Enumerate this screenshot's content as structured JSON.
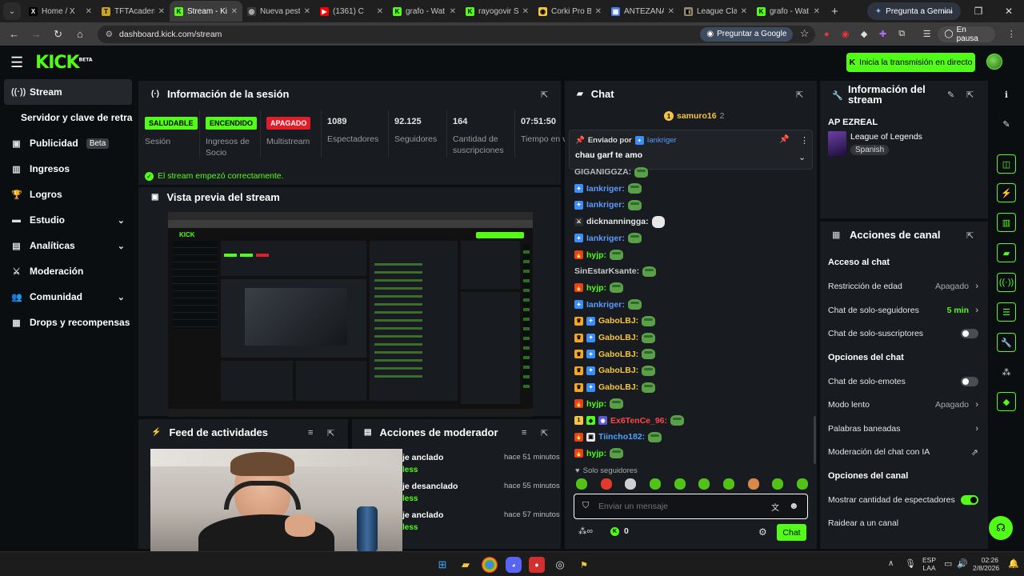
{
  "browser": {
    "tabs": [
      {
        "title": "Home / X",
        "fav": "X",
        "color": "#000000",
        "fg": "#ffffff"
      },
      {
        "title": "TFTAcadem",
        "fav": "T",
        "color": "#c9a227",
        "fg": "#000000"
      },
      {
        "title": "Stream - Kic",
        "fav": "K",
        "color": "#53fc18",
        "fg": "#000000"
      },
      {
        "title": "Nueva pesta",
        "fav": "◎",
        "color": "#3c3c3c",
        "fg": "#ffffff"
      },
      {
        "title": "(1361) C",
        "fav": "▶",
        "color": "#ff0000",
        "fg": "#ffffff"
      },
      {
        "title": "grafo - Wat",
        "fav": "K",
        "color": "#53fc18",
        "fg": "#000000"
      },
      {
        "title": "rayogovir S",
        "fav": "K",
        "color": "#53fc18",
        "fg": "#000000"
      },
      {
        "title": "Corki Pro B",
        "fav": "◉",
        "color": "#f4c542",
        "fg": "#000000"
      },
      {
        "title": "ANTEZANA",
        "fav": "▦",
        "color": "#4a7cf6",
        "fg": "#ffffff"
      },
      {
        "title": "League Clas",
        "fav": "◧",
        "color": "#9a8b6e",
        "fg": "#000000"
      },
      {
        "title": "grafo - Wat",
        "fav": "K",
        "color": "#53fc18",
        "fg": "#000000"
      }
    ],
    "gemini_label": "Pregunta a Gemini",
    "url": "dashboard.kick.com/stream",
    "google_label": "Preguntar a Google",
    "pause_label": "En pausa"
  },
  "header": {
    "logo": "KICK",
    "logo_sup": "BETA",
    "live_button": "Inicia la transmisión en directo"
  },
  "sidebar": {
    "items": [
      {
        "label": "Stream",
        "icon": "broadcast-icon",
        "glyph": "((·))",
        "active": true
      },
      {
        "label": "Servidor y clave de retransmisión",
        "sub": true
      },
      {
        "label": "Publicidad",
        "icon": "calendar-icon",
        "glyph": "▣",
        "badge": "Beta"
      },
      {
        "label": "Ingresos",
        "icon": "chart-icon",
        "glyph": "▥"
      },
      {
        "label": "Logros",
        "icon": "trophy-icon",
        "glyph": "🏆"
      },
      {
        "label": "Estudio",
        "icon": "studio-icon",
        "glyph": "▬",
        "chevron": true
      },
      {
        "label": "Analíticas",
        "icon": "analytics-icon",
        "glyph": "▤",
        "chevron": true
      },
      {
        "label": "Moderación",
        "icon": "sword-icon",
        "glyph": "⚔"
      },
      {
        "label": "Comunidad",
        "icon": "community-icon",
        "glyph": "👥",
        "chevron": true
      },
      {
        "label": "Drops y recompensas",
        "icon": "gift-icon",
        "glyph": "▦"
      }
    ]
  },
  "session": {
    "title": "Información de la sesión",
    "stats": [
      {
        "pill": "SALUDABLE",
        "pill_bg": "#53fc18",
        "label": "Sesión"
      },
      {
        "pill": "ENCENDIDO",
        "pill_bg": "#53fc18",
        "label": "Ingresos de Socio"
      },
      {
        "pill": "APAGADO",
        "pill_bg": "#e11d2a",
        "label": "Multistream"
      },
      {
        "value": "1089",
        "label": "Espectadores"
      },
      {
        "value": "92.125",
        "label": "Seguidores"
      },
      {
        "value": "164",
        "label": "Cantidad de suscripciones"
      },
      {
        "value": "07:51:50",
        "label": "Tiempo en vivo"
      }
    ],
    "status_msg": "El stream empezó correctamente."
  },
  "preview": {
    "title": "Vista previa del stream"
  },
  "feed": {
    "title": "Feed de actividades"
  },
  "modactions": {
    "title": "Acciones de moderador",
    "rows": [
      {
        "text": "je anclado",
        "sub": "less",
        "time": "hace 51 minutos"
      },
      {
        "text": "je desanclado",
        "sub": "less",
        "time": "hace 55 minutos"
      },
      {
        "text": "je anclado",
        "sub": "less",
        "time": "hace 57 minutos"
      }
    ]
  },
  "chat": {
    "title": "Chat",
    "top_user": "samuro16",
    "top_count": "2",
    "pinned_by_label": "Enviado por",
    "pinned_user": "Iankriger",
    "pinned_msg": "chau garf te amo",
    "messages": [
      {
        "user": "GIGANIGGZA:",
        "color": "#b8b8b8",
        "badges": []
      },
      {
        "user": "Iankriger:",
        "color": "#5b9bff",
        "badges": [
          "vip"
        ]
      },
      {
        "user": "Iankriger:",
        "color": "#5b9bff",
        "badges": [
          "vip"
        ]
      },
      {
        "user": "dicknanningga:",
        "color": "#e6e6e6",
        "badges": [
          "mod"
        ],
        "emote": "white"
      },
      {
        "user": "Iankriger:",
        "color": "#5b9bff",
        "badges": [
          "vip"
        ]
      },
      {
        "user": "hyjp:",
        "color": "#53fc18",
        "badges": [
          "fire"
        ]
      },
      {
        "user": "SinEstarKsante:",
        "color": "#c8c8c8",
        "badges": []
      },
      {
        "user": "hyjp:",
        "color": "#53fc18",
        "badges": [
          "fire"
        ]
      },
      {
        "user": "Iankriger:",
        "color": "#5b9bff",
        "badges": [
          "vip"
        ]
      },
      {
        "user": "GaboLBJ:",
        "color": "#f5c542",
        "badges": [
          "sub",
          "vip"
        ]
      },
      {
        "user": "GaboLBJ:",
        "color": "#f5c542",
        "badges": [
          "sub",
          "vip"
        ]
      },
      {
        "user": "GaboLBJ:",
        "color": "#f5c542",
        "badges": [
          "sub",
          "vip"
        ]
      },
      {
        "user": "GaboLBJ:",
        "color": "#f5c542",
        "badges": [
          "sub",
          "vip"
        ]
      },
      {
        "user": "GaboLBJ:",
        "color": "#f5c542",
        "badges": [
          "sub",
          "vip"
        ]
      },
      {
        "user": "hyjp:",
        "color": "#53fc18",
        "badges": [
          "fire"
        ]
      },
      {
        "user": "Ex6TenCe_96:",
        "color": "#ff4747",
        "badges": [
          "gold",
          "green",
          "og"
        ]
      },
      {
        "user": "Tiincho182:",
        "color": "#4aa3ff",
        "badges": [
          "fire",
          "gift"
        ]
      },
      {
        "user": "hyjp:",
        "color": "#53fc18",
        "badges": [
          "fire"
        ]
      }
    ],
    "followers_only": "Solo seguidores",
    "input_placeholder": "Enviar un mensaje",
    "points": "0",
    "send_label": "Chat"
  },
  "streaminfo": {
    "title": "Información del stream",
    "stream_title": "AP EZREAL",
    "category": "League of Legends",
    "language": "Spanish"
  },
  "channel": {
    "title": "Acciones de canal",
    "sections": [
      {
        "heading": "Acceso al chat",
        "rows": [
          {
            "label": "Restricción de edad",
            "value": "Apagado",
            "kind": "arrow"
          },
          {
            "label": "Chat de solo-seguidores",
            "value": "5 min",
            "kind": "arrow-green"
          },
          {
            "label": "Chat de solo-suscriptores",
            "kind": "toggle",
            "on": false
          }
        ]
      },
      {
        "heading": "Opciones del chat",
        "rows": [
          {
            "label": "Chat de solo-emotes",
            "kind": "toggle",
            "on": false
          },
          {
            "label": "Modo lento",
            "value": "Apagado",
            "kind": "arrow"
          },
          {
            "label": "Palabras baneadas",
            "kind": "arrow"
          },
          {
            "label": "Moderación del chat con IA",
            "kind": "external"
          }
        ]
      },
      {
        "heading": "Opciones del canal",
        "rows": [
          {
            "label": "Mostrar cantidad de espectadores",
            "kind": "toggle",
            "on": true
          },
          {
            "label": "Raidear a un canal",
            "kind": "none"
          }
        ]
      }
    ]
  },
  "taskbar": {
    "lang": "ESP",
    "lang2": "LAA",
    "time": "02:26",
    "date": "2/8/2026"
  }
}
